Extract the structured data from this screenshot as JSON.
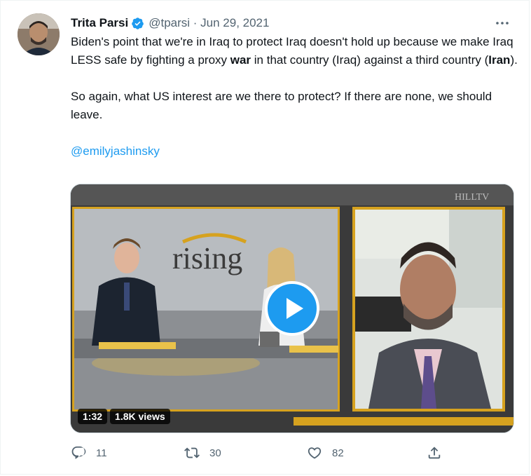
{
  "tweet": {
    "author_name": "Trita Parsi",
    "handle_date": "@tparsi · Jun 29, 2021",
    "para1": {
      "t1": "Biden's point that we're in Iraq to protect Iraq doesn't hold up because we make Iraq LESS safe by fighting a proxy ",
      "b1": "war",
      "t2": " in that country (Iraq) against a third country (",
      "b2": "Iran",
      "t3": ")."
    },
    "para2": "So again, what US interest are we there to protect? If there are none, we should leave.",
    "mention": "@emilyjashinsky"
  },
  "media": {
    "duration": "1:32",
    "views": "1.8K views",
    "show_logo": "rising",
    "watermark": "HILLTV"
  },
  "actions": {
    "reply_count": "11",
    "retweet_count": "30",
    "like_count": "82"
  },
  "colors": {
    "accent": "#1d9bf0",
    "secondary_text": "#536471",
    "frame_gold": "#d6a21f"
  }
}
